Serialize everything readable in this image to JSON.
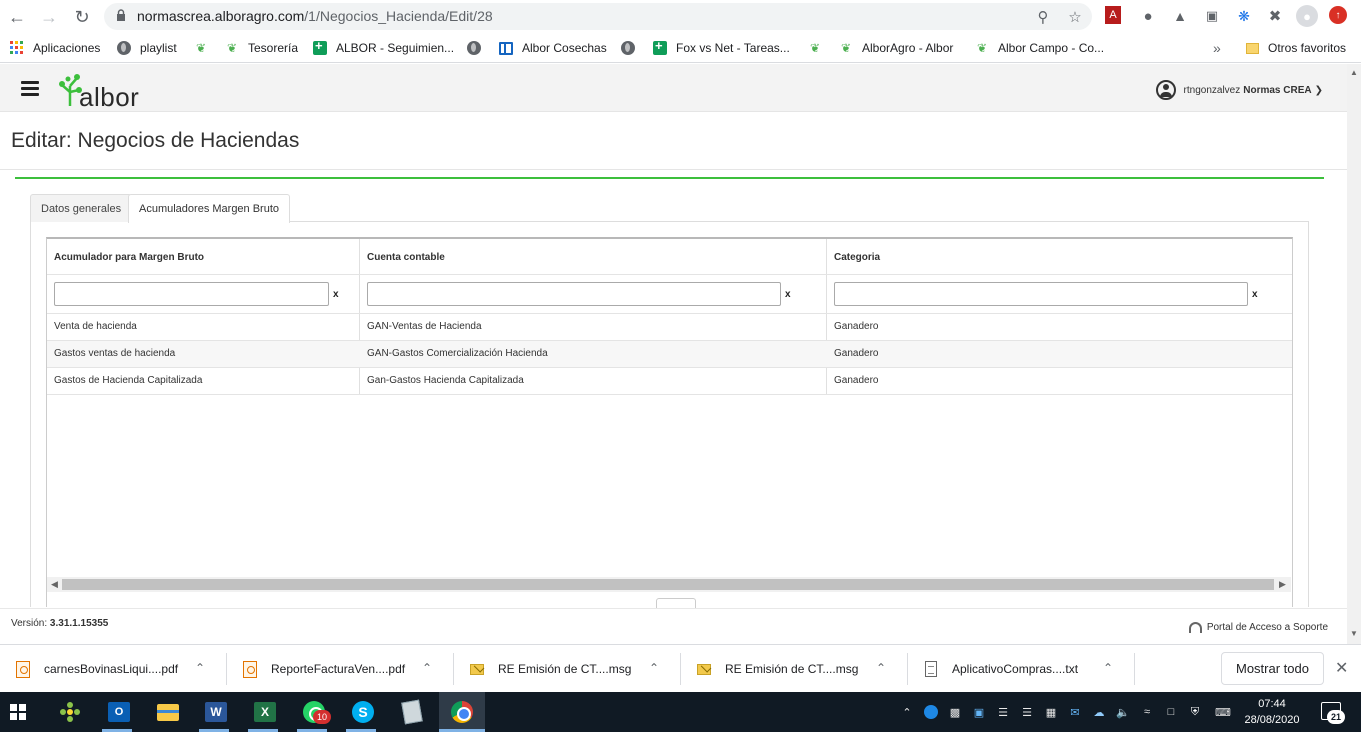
{
  "browser": {
    "url_host": "normascrea.alboragro.com",
    "url_path": "/1/Negocios_Hacienda/Edit/28",
    "bookmarks": [
      {
        "label": "Aplicaciones",
        "icon": "apps-grid-icon"
      },
      {
        "label": "playlist",
        "icon": "globe-icon"
      },
      {
        "label": "",
        "icon": "sprout-icon"
      },
      {
        "label": "Tesorería",
        "icon": "sprout-icon"
      },
      {
        "label": "ALBOR - Seguimien...",
        "icon": "sheets-icon"
      },
      {
        "label": "",
        "icon": "globe-icon"
      },
      {
        "label": "Albor Cosechas",
        "icon": "board-icon"
      },
      {
        "label": "",
        "icon": "globe-icon"
      },
      {
        "label": "Fox vs Net - Tareas...",
        "icon": "sheets-icon"
      },
      {
        "label": "",
        "icon": "sprout-icon"
      },
      {
        "label": "AlborAgro - Albor",
        "icon": "sprout-icon"
      },
      {
        "label": "Albor Campo - Co...",
        "icon": "sprout-icon"
      }
    ],
    "bookmarks_overflow": "»",
    "other_bookmarks": "Otros favoritos"
  },
  "app": {
    "logo_text": "albor",
    "user_name": "rtngonzalvez",
    "user_role": "Normas CREA",
    "page_title": "Editar: Negocios de Haciendas",
    "tabs": [
      {
        "label": "Datos generales",
        "active": false
      },
      {
        "label": "Acumuladores Margen Bruto",
        "active": true
      }
    ],
    "grid": {
      "columns": [
        "Acumulador para Margen Bruto",
        "Cuenta contable",
        "Categoria"
      ],
      "filter_clear": "x",
      "rows": [
        [
          "Venta de hacienda",
          "GAN-Ventas de Hacienda",
          "Ganadero"
        ],
        [
          "Gastos ventas de hacienda",
          "GAN-Gastos Comercialización Hacienda",
          "Ganadero"
        ],
        [
          "Gastos de Hacienda Capitalizada",
          "Gan-Gastos Hacienda Capitalizada",
          "Ganadero"
        ]
      ]
    },
    "footer": {
      "version_label": "Versión:",
      "version_value": "3.31.1.15355",
      "support_link": "Portal de Acceso a Soporte"
    },
    "colors": {
      "accent": "#3cbf3c",
      "logo_green": "#3cbf3c"
    }
  },
  "downloads": {
    "items": [
      {
        "label": "carnesBovinasLiqui....pdf",
        "icon": "pdf-icon"
      },
      {
        "label": "ReporteFacturaVen....pdf",
        "icon": "pdf-icon"
      },
      {
        "label": "RE Emisión de CT....msg",
        "icon": "mail-icon"
      },
      {
        "label": "RE Emisión de CT....msg",
        "icon": "mail-icon"
      },
      {
        "label": "AplicativoCompras....txt",
        "icon": "text-file-icon"
      }
    ],
    "show_all": "Mostrar todo"
  },
  "taskbar": {
    "whatsapp_badge": "10",
    "time": "07:44",
    "date": "28/08/2020",
    "notifications": "21"
  }
}
